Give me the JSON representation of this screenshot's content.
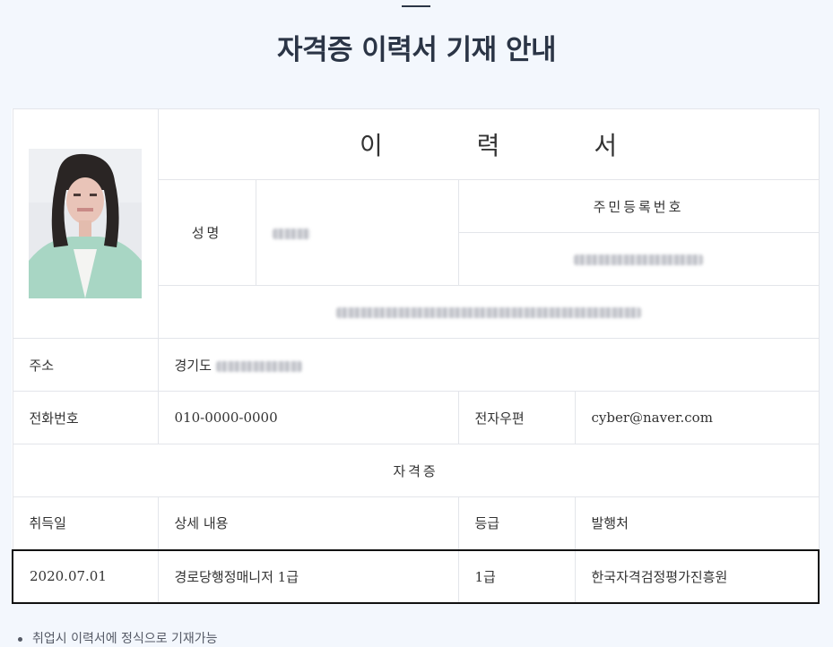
{
  "page": {
    "title": "자격증 이력서 기재 안내"
  },
  "resume": {
    "doc_title_chars": [
      "이",
      "력",
      "서"
    ],
    "name_label": "성명",
    "id_label": "주민등록번호",
    "address_label": "주소",
    "address_value": "경기도",
    "phone_label": "전화번호",
    "phone_value": "010-0000-0000",
    "email_label": "전자우편",
    "email_value": "cyber@naver.com",
    "cert_section_title": "자격증",
    "columns": [
      "취득일",
      "상세 내용",
      "등급",
      "발행처"
    ],
    "cert_row": {
      "date": "2020.07.01",
      "detail": "경로당행정매니저 1급",
      "grade": "1급",
      "issuer": "한국자격검정평가진흥원"
    }
  },
  "note": {
    "text": "취업시 이력서에 정식으로 기재가능"
  },
  "icons": {
    "photo": "profile-photo",
    "bullet": "bullet-dot-icon"
  },
  "colors": {
    "background": "#f3f7fd",
    "title": "#2b3546",
    "border": "#e3e5ea",
    "highlight_border": "#111111"
  }
}
